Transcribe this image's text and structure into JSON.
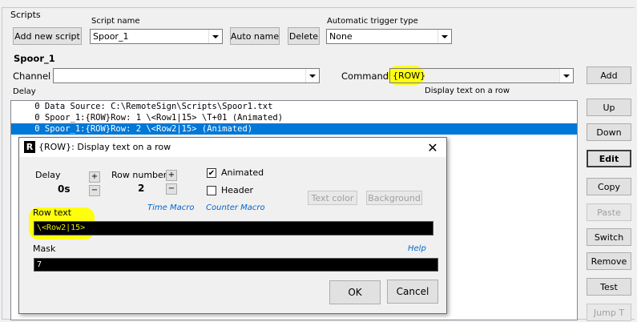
{
  "group": {
    "title": "Scripts"
  },
  "top": {
    "add_script_label": "Add new script",
    "script_name_label": "Script name",
    "script_name_value": "Spoor_1",
    "auto_name_label": "Auto name",
    "delete_label": "Delete",
    "trigger_label": "Automatic trigger type",
    "trigger_value": "None"
  },
  "section": {
    "script_heading": "Spoor_1",
    "channel_label": "Channel",
    "channel_value": "",
    "command_label": "Command",
    "command_value": "{ROW}",
    "command_desc": "Display text on a row",
    "delay_col": "Delay"
  },
  "list": {
    "rows": [
      "    0 Data Source: C:\\RemoteSign\\Scripts\\Spoor1.txt",
      "    0 Spoor_1:{ROW}Row: 1 \\<Row1|15> \\T+01 (Animated)",
      "    0 Spoor_1:{ROW}Row: 2 \\<Row2|15> (Animated)"
    ],
    "selected_index": 2
  },
  "right_buttons": {
    "add": "Add",
    "up": "Up",
    "down": "Down",
    "edit": "Edit",
    "copy": "Copy",
    "paste": "Paste",
    "switch": "Switch",
    "remove": "Remove",
    "test": "Test",
    "jump": "Jump T"
  },
  "dialog": {
    "icon": "R",
    "title": "{ROW}: Display text on a row",
    "delay_label": "Delay",
    "delay_value": "0s",
    "row_number_label": "Row number",
    "row_number_value": "2",
    "animated_label": "Animated",
    "animated_checked": true,
    "header_label": "Header",
    "header_checked": false,
    "text_color_label": "Text color",
    "background_label": "Background",
    "time_macro": "Time Macro",
    "counter_macro": "Counter Macro",
    "row_text_label": "Row text",
    "row_text_value": "\\<Row2|15>",
    "mask_label": "Mask",
    "help_label": "Help",
    "mask_value": "7",
    "ok_label": "OK",
    "cancel_label": "Cancel"
  },
  "colors": {
    "selection": "#0078d7",
    "highlight": "#ffff00",
    "link": "#0066cc"
  }
}
